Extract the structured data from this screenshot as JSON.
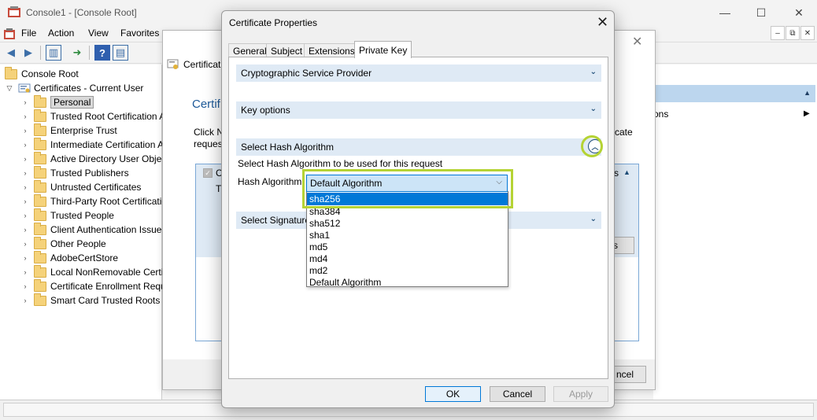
{
  "window": {
    "title": "Console1 - [Console Root]",
    "minimize": "—",
    "maximize": "☐",
    "close": "✕"
  },
  "menu": {
    "items": [
      "File",
      "Action",
      "View",
      "Favorites"
    ],
    "mdi_min": "–",
    "mdi_restore": "⧉",
    "mdi_close": "✕"
  },
  "tree": {
    "root": "Console Root",
    "store": "Certificates - Current User",
    "items": [
      "Personal",
      "Trusted Root Certification A",
      "Enterprise Trust",
      "Intermediate Certification A",
      "Active Directory User Objec",
      "Trusted Publishers",
      "Untrusted Certificates",
      "Third-Party Root Certificatio",
      "Trusted People",
      "Client Authentication Issue",
      "Other People",
      "AdobeCertStore",
      "Local NonRemovable Certi",
      "Certificate Enrollment Requ",
      "Smart Card Trusted Roots"
    ]
  },
  "actions": {
    "item": "ons"
  },
  "wizard": {
    "title": "Certificat",
    "heading": "Certif",
    "text_line1": "Click N",
    "text_line2": "reques",
    "text_right": "cate",
    "box_c": "C",
    "box_t": "T",
    "box_s": "s",
    "box_button": "s",
    "cancel": "ncel",
    "close": "✕"
  },
  "dialog": {
    "title": "Certificate Properties",
    "close": "✕",
    "tabs": [
      "General",
      "Subject",
      "Extensions",
      "Private Key"
    ],
    "sections": {
      "csp": "Cryptographic Service Provider",
      "key_options": "Key options",
      "hash": "Select Hash Algorithm",
      "signature": "Select Signature"
    },
    "hash_description": "Select Hash Algorithm to be used for this request",
    "hash_label": "Hash Algorithm",
    "combo_value": "Default Algorithm",
    "options": [
      "sha256",
      "sha384",
      "sha512",
      "sha1",
      "md5",
      "md4",
      "md2",
      "Default Algorithm"
    ],
    "buttons": {
      "ok": "OK",
      "cancel": "Cancel",
      "apply": "Apply"
    }
  }
}
